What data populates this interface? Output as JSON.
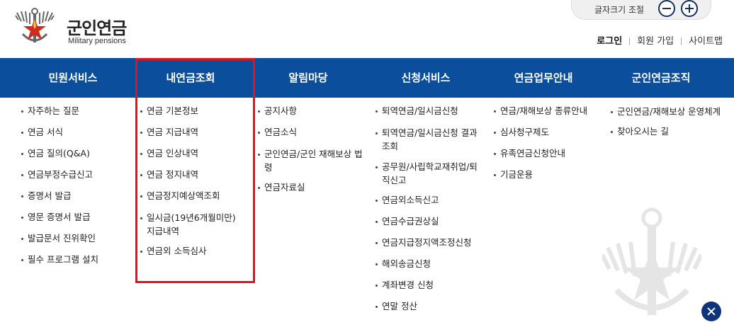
{
  "header": {
    "logo_title": "군인연금",
    "logo_sub": "Military pensions",
    "font_size_label": "글자크기 조절",
    "font_size_decrease_icon": "minus-circle-icon",
    "font_size_increase_icon": "plus-circle-icon",
    "util_links": [
      "로그인",
      "회원 가입",
      "사이트맵"
    ]
  },
  "gnb": [
    "민원서비스",
    "내연금조회",
    "알림마당",
    "신청서비스",
    "연금업무안내",
    "군인연금조직"
  ],
  "menus": {
    "civil": [
      "자주하는 질문",
      "연금 서식",
      "연금 질의(Q&A)",
      "연금부정수급신고",
      "증명서 발급",
      "영문 증명서 발급",
      "발급문서 진위확인",
      "필수 프로그램 설치"
    ],
    "mypension": [
      "연금 기본정보",
      "연금 지급내역",
      "연금 인상내역",
      "연금 정지내역",
      "연금정지예상액조회",
      "일시금(19년6개월미만) 지급내역",
      "연금외 소득심사"
    ],
    "notice": [
      "공지사항",
      "연금소식",
      "군인연금/군인 재해보상 법령",
      "연금자료실"
    ],
    "apply": [
      "퇴역연금/일시금신청",
      "퇴역연금/일시금신청 결과조회",
      "공무원/사립학교재취업/퇴직신고",
      "연금외소득신고",
      "연금수급권상실",
      "연금지급정지액조정신청",
      "해외송금신청",
      "계좌변경 신청",
      "연말 정산"
    ],
    "guide": [
      "연금/재해보상 종류안내",
      "심사청구제도",
      "유족연금신청안내",
      "기금운용"
    ],
    "org": [
      "군인연금/재해보상 운영체계",
      "찾아오시는 길"
    ]
  },
  "colors": {
    "nav_bg": "#0b4f9c",
    "highlight": "#e0141e",
    "close_btn": "#10347a"
  },
  "icons": {
    "logo": "military-emblem-icon",
    "close": "close-icon",
    "watermark": "military-emblem-watermark-icon"
  }
}
